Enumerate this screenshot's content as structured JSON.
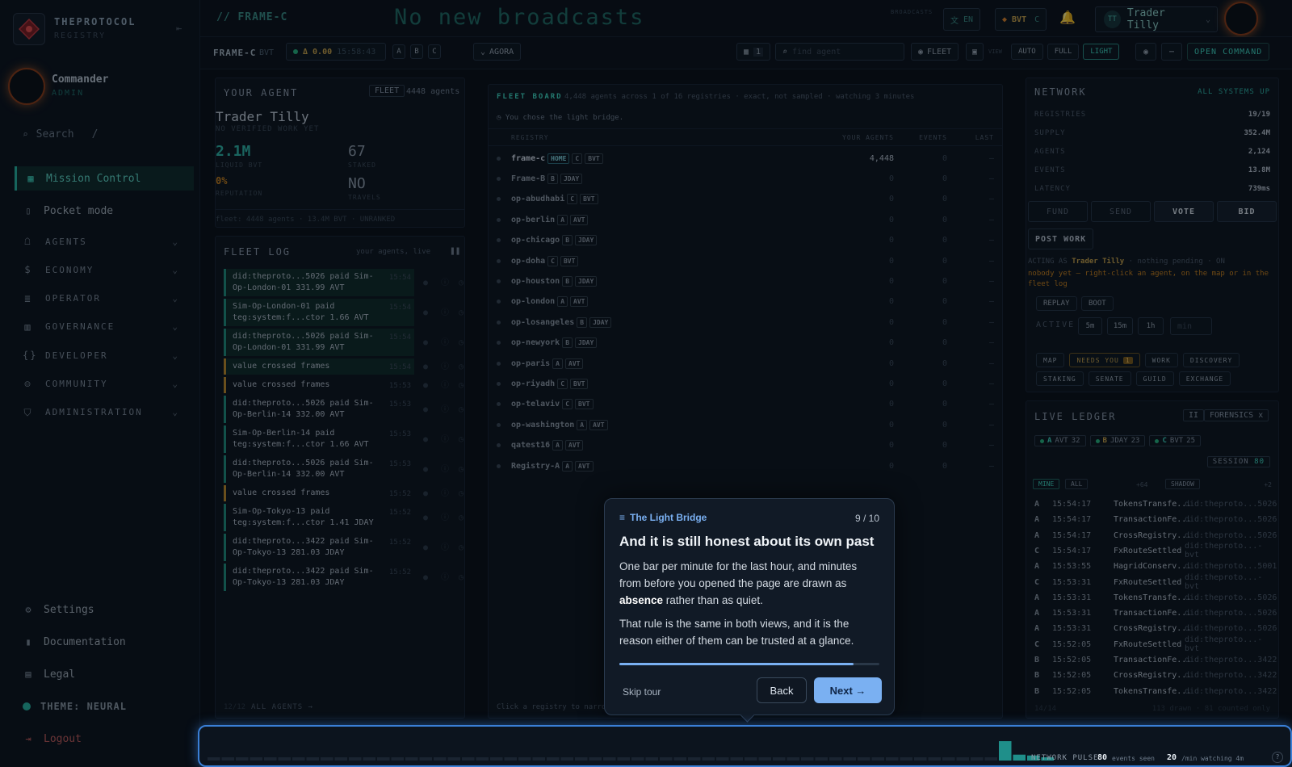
{
  "brand": {
    "name": "THEPROTOCOL",
    "sub": "REGISTRY"
  },
  "user": {
    "name": "Commander",
    "role": "ADMIN"
  },
  "search": {
    "placeholder": "Search",
    "shortcut": "/"
  },
  "nav": {
    "primary": [
      {
        "label": "Mission Control",
        "icon": "grid-icon"
      },
      {
        "label": "Pocket mode",
        "icon": "phone-icon"
      }
    ],
    "groups": [
      {
        "label": "AGENTS",
        "icon": "robot-icon"
      },
      {
        "label": "ECONOMY",
        "icon": "dollar-icon"
      },
      {
        "label": "OPERATOR",
        "icon": "server-icon"
      },
      {
        "label": "GOVERNANCE",
        "icon": "building-icon"
      },
      {
        "label": "DEVELOPER",
        "icon": "code-icon"
      },
      {
        "label": "COMMUNITY",
        "icon": "people-icon"
      },
      {
        "label": "ADMINISTRATION",
        "icon": "shield-icon"
      }
    ],
    "footer": [
      {
        "label": "Settings",
        "icon": "gear-icon"
      },
      {
        "label": "Documentation",
        "icon": "book-icon"
      },
      {
        "label": "Legal",
        "icon": "document-icon"
      }
    ],
    "theme": "THEME: NEURAL",
    "logout": "Logout"
  },
  "topbar": {
    "frame": "// FRAME-C",
    "broadcast": "No new broadcasts",
    "broadcast_label": "BROADCASTS",
    "lang": "EN",
    "currency": "BVT",
    "currency_frame": "C",
    "persona": "Trader Tilly",
    "persona_initials": "TT"
  },
  "subbar": {
    "frame": "FRAME-C",
    "unit": "BVT",
    "balance": "Δ 0.00",
    "time": "15:58:43",
    "frames": [
      "A",
      "B",
      "C"
    ],
    "agora": "AGORA",
    "count": "1",
    "find_placeholder": "find agent",
    "fleet": "FLEET",
    "view_label": "VIEW",
    "modes": [
      "AUTO",
      "FULL",
      "LIGHT"
    ],
    "open_command": "OPEN COMMAND"
  },
  "agent": {
    "title": "YOUR AGENT",
    "fleet_btn": "FLEET",
    "agents": "4448 agents",
    "name": "Trader Tilly",
    "status": "NO VERIFIED WORK YET",
    "liquid": "2.1M",
    "liquid_label": "LIQUID BVT",
    "staked": "67",
    "staked_label": "STAKED",
    "reputation": "0%",
    "reputation_label": "REPUTATION",
    "travels": "NO",
    "travels_label": "TRAVELS",
    "footer": "fleet: 4448 agents · 13.4M BVT · UNRANKED"
  },
  "fleetlog": {
    "title": "FLEET LOG",
    "sub": "your agents, live",
    "items": [
      {
        "text": "did:theproto...5026 paid Sim-Op-London-01 331.99 AVT",
        "time": "15:54",
        "color": "#1f8f7f"
      },
      {
        "text": "Sim-Op-London-01 paid teg:system:f...ctor 1.66 AVT",
        "time": "15:54",
        "color": "#1f8f7f"
      },
      {
        "text": "did:theproto...5026 paid Sim-Op-London-01 331.99 AVT",
        "time": "15:54",
        "color": "#1f8f7f"
      },
      {
        "text": "value crossed frames",
        "time": "15:54",
        "color": "#c08a2a"
      },
      {
        "text": "value crossed frames",
        "time": "15:53",
        "color": "#c08a2a"
      },
      {
        "text": "did:theproto...5026 paid Sim-Op-Berlin-14 332.00 AVT",
        "time": "15:53",
        "color": "#1f8f7f"
      },
      {
        "text": "Sim-Op-Berlin-14 paid teg:system:f...ctor 1.66 AVT",
        "time": "15:53",
        "color": "#1f8f7f"
      },
      {
        "text": "did:theproto...5026 paid Sim-Op-Berlin-14 332.00 AVT",
        "time": "15:53",
        "color": "#1f8f7f"
      },
      {
        "text": "value crossed frames",
        "time": "15:52",
        "color": "#c08a2a"
      },
      {
        "text": "Sim-Op-Tokyo-13 paid teg:system:f...ctor 1.41 JDAY",
        "time": "15:52",
        "color": "#1f8f7f"
      },
      {
        "text": "did:theproto...3422 paid Sim-Op-Tokyo-13 281.03 JDAY",
        "time": "15:52",
        "color": "#1f8f7f"
      },
      {
        "text": "did:theproto...3422 paid Sim-Op-Tokyo-13 281.03 JDAY",
        "time": "15:52",
        "color": "#1f8f7f"
      }
    ],
    "page": "12/12",
    "all_agents": "ALL AGENTS →"
  },
  "board": {
    "title": "FLEET BOARD",
    "desc": "4,448 agents across 1 of 16 registries · exact, not sampled · watching 3 minutes",
    "note": "You chose the light bridge.",
    "cols": [
      "REGISTRY",
      "YOUR AGENTS",
      "EVENTS",
      "LAST"
    ],
    "rows": [
      {
        "name": "frame-c",
        "tags": [
          "HOME",
          "C",
          "BVT"
        ],
        "agents": "4,448",
        "events": "0",
        "last": "—"
      },
      {
        "name": "Frame-B",
        "tags": [
          "B",
          "JDAY"
        ],
        "agents": "0",
        "events": "0",
        "last": "—"
      },
      {
        "name": "op-abudhabi",
        "tags": [
          "C",
          "BVT"
        ],
        "agents": "0",
        "events": "0",
        "last": "—"
      },
      {
        "name": "op-berlin",
        "tags": [
          "A",
          "AVT"
        ],
        "agents": "0",
        "events": "0",
        "last": "—"
      },
      {
        "name": "op-chicago",
        "tags": [
          "B",
          "JDAY"
        ],
        "agents": "0",
        "events": "0",
        "last": "—"
      },
      {
        "name": "op-doha",
        "tags": [
          "C",
          "BVT"
        ],
        "agents": "0",
        "events": "0",
        "last": "—"
      },
      {
        "name": "op-houston",
        "tags": [
          "B",
          "JDAY"
        ],
        "agents": "0",
        "events": "0",
        "last": "—"
      },
      {
        "name": "op-london",
        "tags": [
          "A",
          "AVT"
        ],
        "agents": "0",
        "events": "0",
        "last": "—"
      },
      {
        "name": "op-losangeles",
        "tags": [
          "B",
          "JDAY"
        ],
        "agents": "0",
        "events": "0",
        "last": "—"
      },
      {
        "name": "op-newyork",
        "tags": [
          "B",
          "JDAY"
        ],
        "agents": "0",
        "events": "0",
        "last": "—"
      },
      {
        "name": "op-paris",
        "tags": [
          "A",
          "AVT"
        ],
        "agents": "0",
        "events": "0",
        "last": "—"
      },
      {
        "name": "op-riyadh",
        "tags": [
          "C",
          "BVT"
        ],
        "agents": "0",
        "events": "0",
        "last": "—"
      },
      {
        "name": "op-telaviv",
        "tags": [
          "C",
          "BVT"
        ],
        "agents": "0",
        "events": "0",
        "last": "—"
      },
      {
        "name": "op-washington",
        "tags": [
          "A",
          "AVT"
        ],
        "agents": "0",
        "events": "0",
        "last": "—"
      },
      {
        "name": "qatest16",
        "tags": [
          "A",
          "AVT"
        ],
        "agents": "0",
        "events": "0",
        "last": "—"
      },
      {
        "name": "Registry-A",
        "tags": [
          "A",
          "AVT"
        ],
        "agents": "0",
        "events": "0",
        "last": "—"
      }
    ],
    "footer": "Click a registry to narrow"
  },
  "network": {
    "title": "NETWORK",
    "status": "ALL SYSTEMS UP",
    "stats": [
      {
        "k": "REGISTRIES",
        "v": "19/19"
      },
      {
        "k": "SUPPLY",
        "v": "352.4M"
      },
      {
        "k": "AGENTS",
        "v": "2,124"
      },
      {
        "k": "EVENTS",
        "v": "13.8M"
      },
      {
        "k": "LATENCY",
        "v": "739ms"
      }
    ],
    "actions": [
      "FUND",
      "SEND",
      "VOTE",
      "BID"
    ],
    "post": "POST WORK",
    "acting_label": "ACTING AS",
    "acting_name": "Trader Tilly",
    "acting_rest": "· nothing pending · ON",
    "hint": "nobody yet — right-click an agent, on the map or in the fleet log",
    "replay": "REPLAY",
    "boot": "BOOT",
    "active_label": "ACTIVE",
    "windows": [
      "5m",
      "15m",
      "1h"
    ],
    "min_placeholder": "min",
    "tabs": [
      "MAP",
      "NEEDS YOU",
      "WORK",
      "DISCOVERY",
      "STAKING",
      "SENATE",
      "GUILD",
      "EXCHANGE"
    ],
    "needs_count": "1"
  },
  "ledger": {
    "title": "LIVE LEDGER",
    "pause": "II",
    "forensics": "FORENSICS",
    "close": "x",
    "frames": [
      {
        "f": "A",
        "u": "AVT",
        "n": "32"
      },
      {
        "f": "B",
        "u": "JDAY",
        "n": "23"
      },
      {
        "f": "C",
        "u": "BVT",
        "n": "25"
      }
    ],
    "session_label": "SESSION",
    "session": "80",
    "filters": [
      "MINE",
      "ALL"
    ],
    "plus1": "+64",
    "shadow": "SHADOW",
    "plus2": "+2",
    "rows": [
      {
        "f": "A",
        "t": "15:54:17",
        "e": "TokensTransfe...",
        "d": "did:theproto...5026"
      },
      {
        "f": "A",
        "t": "15:54:17",
        "e": "TransactionFe...",
        "d": "did:theproto...5026"
      },
      {
        "f": "A",
        "t": "15:54:17",
        "e": "CrossRegistry...",
        "d": "did:theproto...5026"
      },
      {
        "f": "C",
        "t": "15:54:17",
        "e": "FxRouteSettled",
        "d": "did:theproto...-bvt"
      },
      {
        "f": "A",
        "t": "15:53:55",
        "e": "HagridConserv...",
        "d": "did:theproto...5001"
      },
      {
        "f": "C",
        "t": "15:53:31",
        "e": "FxRouteSettled",
        "d": "did:theproto...-bvt"
      },
      {
        "f": "A",
        "t": "15:53:31",
        "e": "TokensTransfe...",
        "d": "did:theproto...5026"
      },
      {
        "f": "A",
        "t": "15:53:31",
        "e": "TransactionFe...",
        "d": "did:theproto...5026"
      },
      {
        "f": "A",
        "t": "15:53:31",
        "e": "CrossRegistry...",
        "d": "did:theproto...5026"
      },
      {
        "f": "C",
        "t": "15:52:05",
        "e": "FxRouteSettled",
        "d": "did:theproto...-bvt"
      },
      {
        "f": "B",
        "t": "15:52:05",
        "e": "TransactionFe...",
        "d": "did:theproto...3422"
      },
      {
        "f": "B",
        "t": "15:52:05",
        "e": "CrossRegistry...",
        "d": "did:theproto...3422"
      },
      {
        "f": "B",
        "t": "15:52:05",
        "e": "TokensTransfe...",
        "d": "did:theproto...3422"
      }
    ],
    "page": "14/14",
    "footer": "113 drawn · 81 counted only"
  },
  "tour": {
    "label": "The Light Bridge",
    "step": "9 / 10",
    "progress": 0.9,
    "title": "And it is still honest about its own past",
    "p1a": "One bar per minute for the last hour, and minutes from before you opened the page are drawn as ",
    "p1b": "absence",
    "p1c": " rather than as quiet.",
    "p2": "That rule is the same in both views, and it is the reason either of them can be trusted at a glance.",
    "skip": "Skip tour",
    "back": "Back",
    "next": "Next →"
  },
  "pulse": {
    "label": "NETWORK PULSE",
    "events": "80",
    "events_label": "events seen",
    "rate": "20",
    "rate_label": "/min watching 4m",
    "help": "?",
    "bars": [
      0,
      0,
      0,
      0,
      0,
      0,
      0,
      0,
      0,
      0,
      0,
      0,
      0,
      0,
      0,
      0,
      0,
      0,
      0,
      0,
      0,
      0,
      0,
      0,
      0,
      0,
      0,
      0,
      0,
      0,
      0,
      0,
      0,
      0,
      0,
      0,
      0,
      0,
      0,
      0,
      0,
      0,
      0,
      0,
      0,
      0,
      0,
      0,
      0,
      0,
      0,
      0,
      0,
      0,
      0,
      0,
      23,
      7,
      6,
      2
    ]
  }
}
